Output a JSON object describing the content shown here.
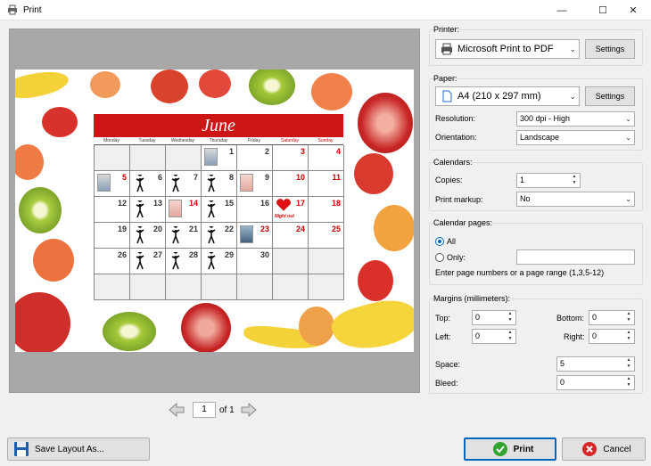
{
  "window": {
    "title": "Print",
    "minimize": "—",
    "maximize": "☐",
    "close": "✕"
  },
  "calendar": {
    "month": "June",
    "weekdays": [
      "Monday",
      "Tuesday",
      "Wednesday",
      "Thursday",
      "Friday",
      "Saturday",
      "Sunday"
    ],
    "weeks": [
      [
        "",
        "",
        "",
        "1",
        "2",
        "3",
        "4"
      ],
      [
        "5",
        "6",
        "7",
        "8",
        "9",
        "10",
        "11"
      ],
      [
        "12",
        "13",
        "14",
        "15",
        "16",
        "17",
        "18"
      ],
      [
        "19",
        "20",
        "21",
        "22",
        "23",
        "24",
        "25"
      ],
      [
        "26",
        "27",
        "28",
        "29",
        "30",
        "",
        ""
      ],
      [
        "",
        "",
        "",
        "",
        "",
        "",
        ""
      ]
    ],
    "notes": {
      "night_out": "Night out"
    }
  },
  "pager": {
    "current": "1",
    "of_label": "of 1"
  },
  "printer": {
    "group_title": "Printer:",
    "selected": "Microsoft Print to PDF",
    "settings_label": "Settings"
  },
  "paper": {
    "group_title": "Paper:",
    "selected": "A4 (210 x 297 mm)",
    "settings_label": "Settings",
    "resolution_label": "Resolution:",
    "resolution_value": "300 dpi - High",
    "orientation_label": "Orientation:",
    "orientation_value": "Landscape"
  },
  "calendars": {
    "group_title": "Calendars:",
    "copies_label": "Copies:",
    "copies_value": "1",
    "markup_label": "Print markup:",
    "markup_value": "No"
  },
  "calendar_pages": {
    "group_title": "Calendar pages:",
    "all_label": "All",
    "only_label": "Only:",
    "hint": "Enter page numbers or a page range (1,3,5-12)"
  },
  "margins": {
    "group_title": "Margins (millimeters):",
    "top_label": "Top:",
    "top_value": "0",
    "bottom_label": "Bottom:",
    "bottom_value": "0",
    "left_label": "Left:",
    "left_value": "0",
    "right_label": "Right:",
    "right_value": "0",
    "space_label": "Space:",
    "space_value": "5",
    "bleed_label": "Bleed:",
    "bleed_value": "0"
  },
  "footer": {
    "save_layout_label": "Save Layout As...",
    "print_label": "Print",
    "cancel_label": "Cancel"
  }
}
